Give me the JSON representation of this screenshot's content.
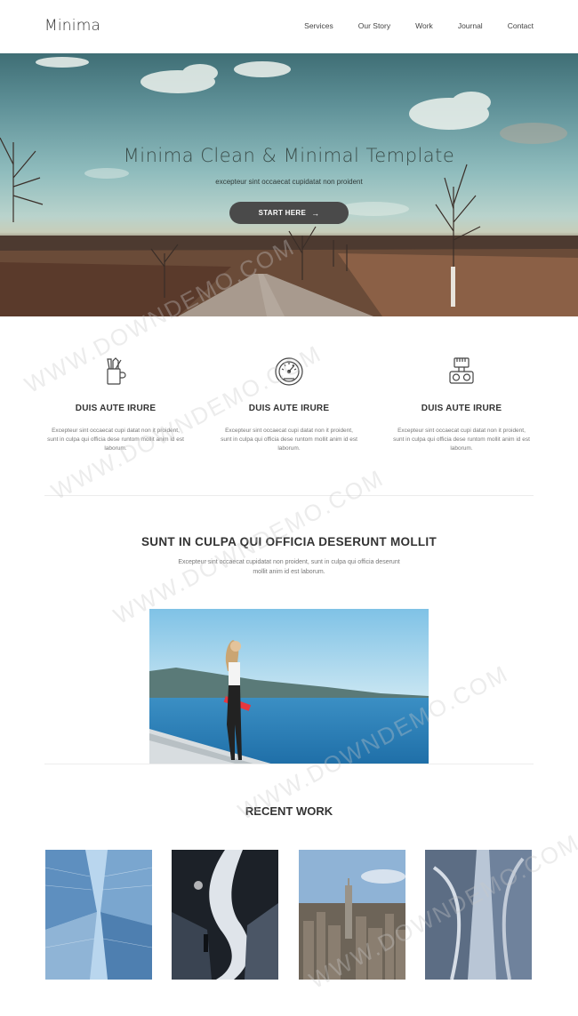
{
  "header": {
    "logo": "Minima",
    "nav": [
      "Services",
      "Our Story",
      "Work",
      "Journal",
      "Contact"
    ]
  },
  "hero": {
    "title": "Minima Clean & Minimal Template",
    "subtitle": "excepteur sint occaecat cupidatat non proident",
    "button_label": "START HERE",
    "button_icon": "arrow-right-icon"
  },
  "features": [
    {
      "icon": "pencil-cup-icon",
      "title": "DUIS AUTE IRURE",
      "text": "Excepteur sint occaecat cupi datat non it proident, sunt in culpa qui officia dese runtom mollit anim id est laborum."
    },
    {
      "icon": "speedometer-icon",
      "title": "DUIS AUTE IRURE",
      "text": "Excepteur sint occaecat cupi datat non it proident, sunt in culpa qui officia dese runtom mollit anim id est laborum."
    },
    {
      "icon": "camera-icon",
      "title": "DUIS AUTE IRURE",
      "text": "Excepteur sint occaecat cupi datat non it proident, sunt in culpa qui officia dese runtom mollit anim id est laborum."
    }
  ],
  "about": {
    "title": "SUNT IN CULPA QUI OFFICIA DESERUNT MOLLIT",
    "text": "Excepteur sint occaecat cupidatat non proident, sunt in culpa qui officia deserunt mollit anim id est laborum."
  },
  "recent_work": {
    "title": "RECENT WORK"
  },
  "watermark": "WWW.DOWNDEMO.COM",
  "colors": {
    "button_bg": "#4a4a4a",
    "text_dark": "#333333",
    "text_muted": "#777777"
  }
}
